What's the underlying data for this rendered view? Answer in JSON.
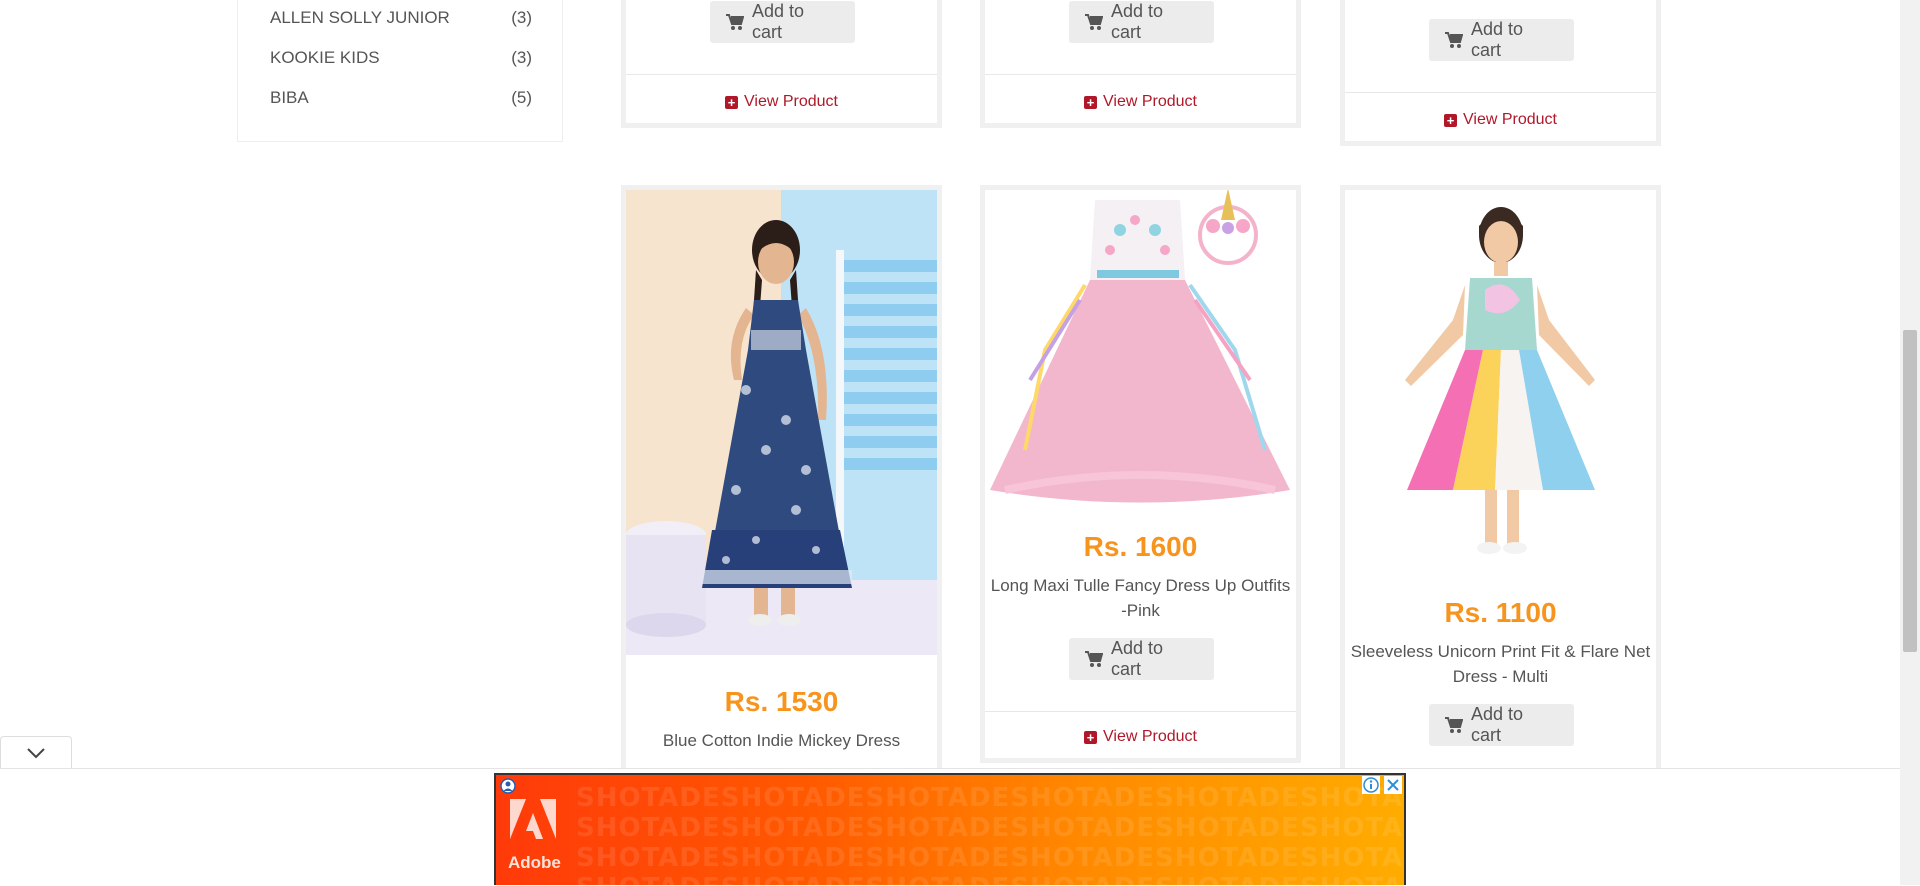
{
  "brands": [
    {
      "name": "ALLEN SOLLY JUNIOR",
      "count": "(3)"
    },
    {
      "name": "KOOKIE KIDS",
      "count": "(3)"
    },
    {
      "name": "BIBA",
      "count": "(5)"
    }
  ],
  "labels": {
    "add_to_cart": "Add to cart",
    "view_product": "View Product"
  },
  "products_top": [
    {
      "id": "top-1"
    },
    {
      "id": "top-2"
    },
    {
      "id": "top-3"
    }
  ],
  "products": [
    {
      "price": "Rs. 1530",
      "name": "Blue Cotton Indie Mickey Dress"
    },
    {
      "price": "Rs. 1600",
      "name_line1": "Long Maxi Tulle Fancy Dress Up Outfits",
      "name_line2": "-Pink"
    },
    {
      "price": "Rs. 1100",
      "name_line1": "Sleeveless Unicorn Print Fit & Flare Net",
      "name_line2": "Dress - Multi"
    }
  ],
  "ad": {
    "brand": "Adobe",
    "pattern_text": "SHOTADESHOTADESHOTADESHOTADESHOTADESHOTADESHOTADESHOTADE"
  },
  "colors": {
    "price": "#f7941d",
    "link": "#b0182a"
  }
}
